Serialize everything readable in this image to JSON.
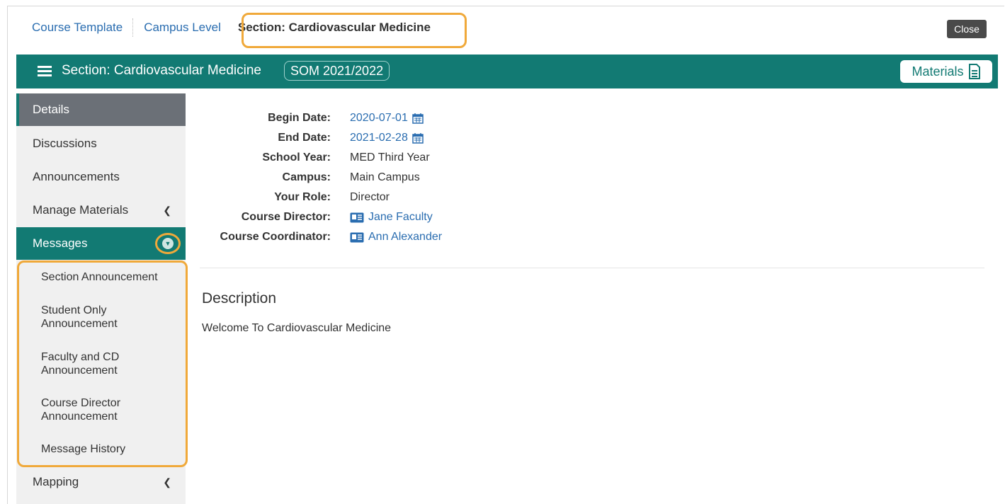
{
  "breadcrumb": {
    "course_template": "Course Template",
    "campus_level": "Campus Level",
    "current": "Section: Cardiovascular Medicine"
  },
  "close_label": "Close",
  "header": {
    "title": "Section: Cardiovascular Medicine",
    "badge": "SOM 2021/2022",
    "materials_label": "Materials"
  },
  "sidebar": {
    "items": [
      {
        "label": "Details"
      },
      {
        "label": "Discussions"
      },
      {
        "label": "Announcements"
      },
      {
        "label": "Manage Materials"
      },
      {
        "label": "Messages"
      },
      {
        "label": "Mapping"
      }
    ],
    "messages_sub": [
      {
        "label": "Section Announcement"
      },
      {
        "label": "Student Only Announcement"
      },
      {
        "label": "Faculty and CD Announcement"
      },
      {
        "label": "Course Director Announcement"
      },
      {
        "label": "Message History"
      }
    ]
  },
  "details": {
    "begin_date_label": "Begin Date:",
    "begin_date": "2020-07-01",
    "end_date_label": "End Date:",
    "end_date": "2021-02-28",
    "school_year_label": "School Year:",
    "school_year": "MED Third Year",
    "campus_label": "Campus:",
    "campus": "Main Campus",
    "role_label": "Your Role:",
    "role": "Director",
    "director_label": "Course Director:",
    "director": "Jane Faculty",
    "coordinator_label": "Course Coordinator:",
    "coordinator": "Ann Alexander"
  },
  "description": {
    "title": "Description",
    "text": "Welcome To Cardiovascular Medicine"
  },
  "colors": {
    "brand_teal": "#127a73",
    "highlight_orange": "#f0a93a",
    "link_blue": "#2a6db0",
    "active_gray": "#6b7077"
  }
}
